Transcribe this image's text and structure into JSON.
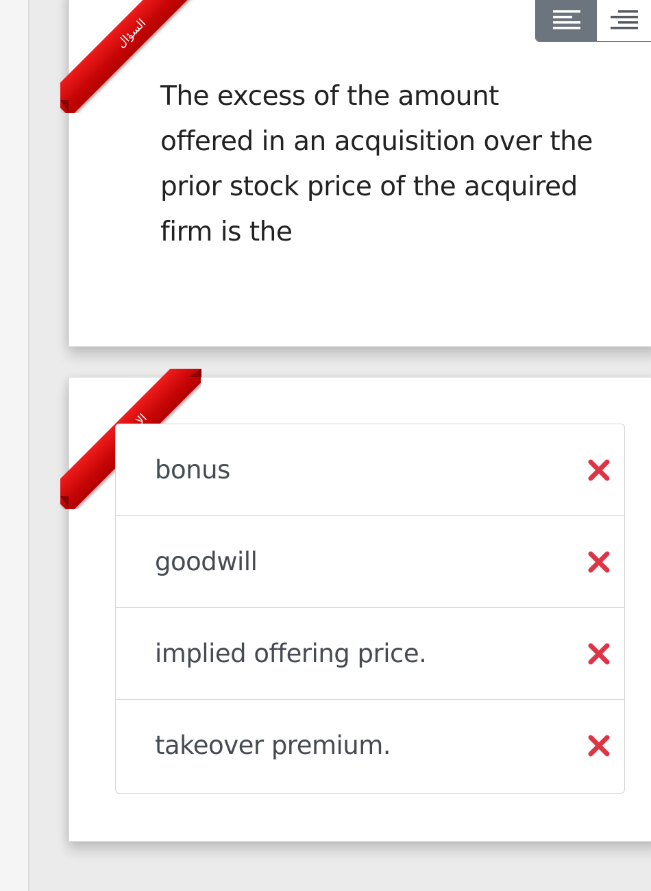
{
  "question": {
    "ribbon_label": "السؤال",
    "text": "The excess of the amount offered in an acquisition over the prior stock price of the acquired firm is the",
    "align_left_icon": "align-left-icon",
    "align_right_icon": "align-right-icon"
  },
  "answers": {
    "ribbon_label": "الاجابات",
    "items": [
      {
        "label": "bonus",
        "status_icon": "wrong-x-icon"
      },
      {
        "label": "goodwill",
        "status_icon": "wrong-x-icon"
      },
      {
        "label": "implied offering price.",
        "status_icon": "wrong-x-icon"
      },
      {
        "label": "takeover premium.",
        "status_icon": "wrong-x-icon"
      }
    ]
  },
  "colors": {
    "ribbon": "#c80606",
    "wrong_mark": "#dc3545",
    "toolbar_active": "#6c757d"
  }
}
